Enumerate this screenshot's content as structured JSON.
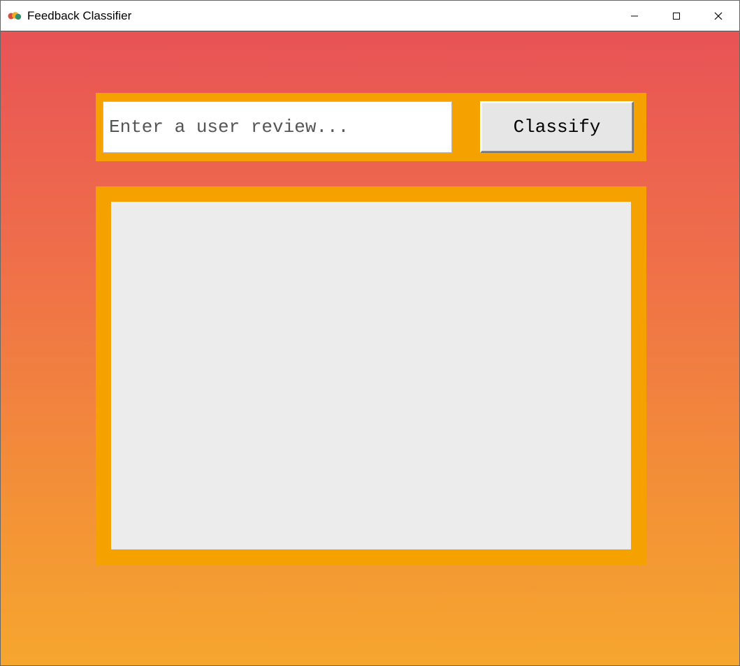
{
  "window": {
    "title": "Feedback Classifier"
  },
  "input": {
    "placeholder": "Enter a user review...",
    "value": ""
  },
  "buttons": {
    "classify": "Classify"
  },
  "output": {
    "text": ""
  }
}
